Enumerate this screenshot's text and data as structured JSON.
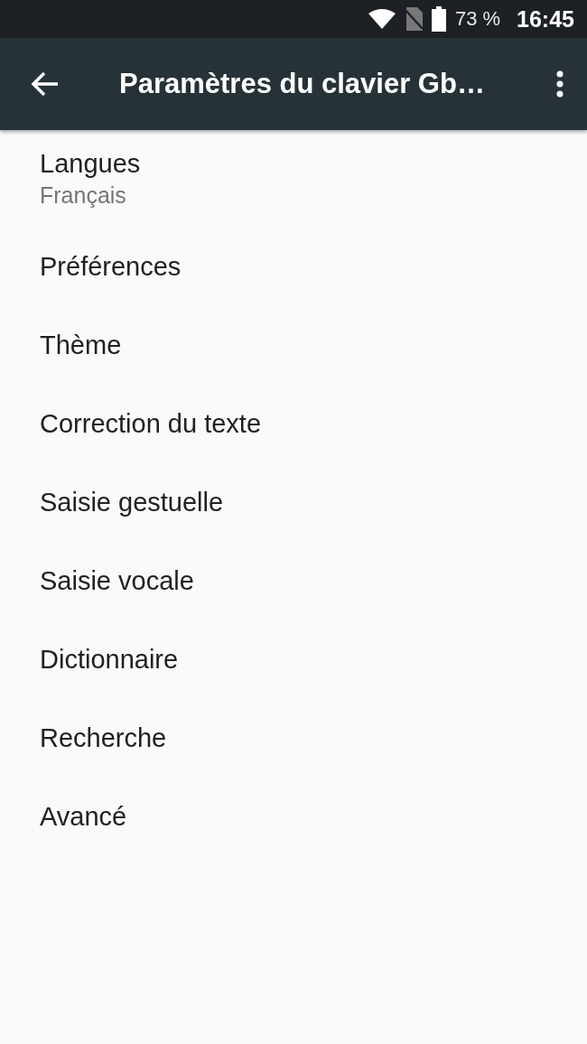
{
  "status_bar": {
    "battery": "73 %",
    "time": "16:45"
  },
  "app_bar": {
    "title": "Paramètres du clavier Gb…"
  },
  "items": [
    {
      "title": "Langues",
      "summary": "Français"
    },
    {
      "title": "Préférences"
    },
    {
      "title": "Thème"
    },
    {
      "title": "Correction du texte"
    },
    {
      "title": "Saisie gestuelle"
    },
    {
      "title": "Saisie vocale"
    },
    {
      "title": "Dictionnaire"
    },
    {
      "title": "Recherche"
    },
    {
      "title": "Avancé"
    }
  ]
}
